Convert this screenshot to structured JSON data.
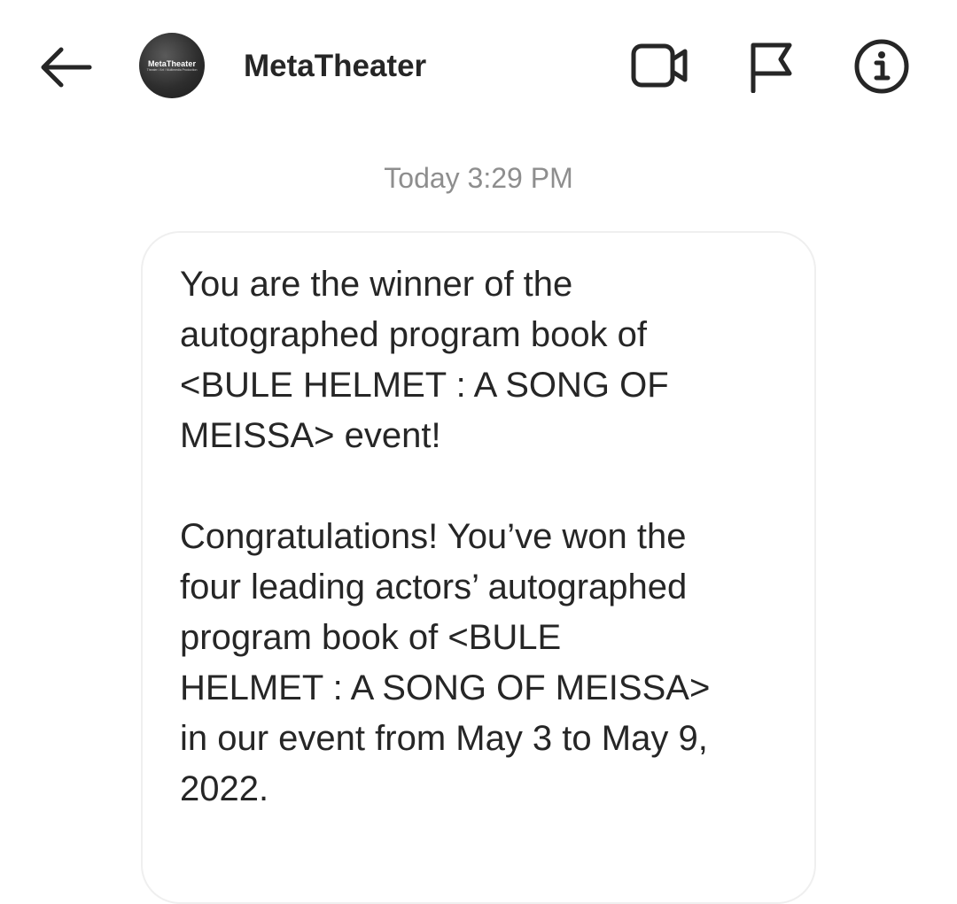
{
  "header": {
    "contact_name": "MetaTheater",
    "avatar_text": "MetaTheater",
    "avatar_subtext": "Theater / Art / Multimedia Production",
    "icons": {
      "back": "arrow-left-icon",
      "video": "video-camera-icon",
      "report": "flag-icon",
      "info": "info-icon"
    }
  },
  "chat": {
    "timestamp": "Today 3:29 PM",
    "message": {
      "paragraph1": "You are the winner of the\nautographed program book of\n<BULE HELMET : A SONG OF\nMEISSA> event!",
      "paragraph2": "Congratulations! You’ve won the\nfour leading actors’ autographed\nprogram book of <BULE\nHELMET : A SONG OF MEISSA>\nin our event from May 3 to May 9,\n2022."
    }
  },
  "colors": {
    "text_primary": "#262626",
    "text_secondary": "#8e8e8e",
    "bubble_border": "#efefef",
    "background": "#ffffff"
  }
}
